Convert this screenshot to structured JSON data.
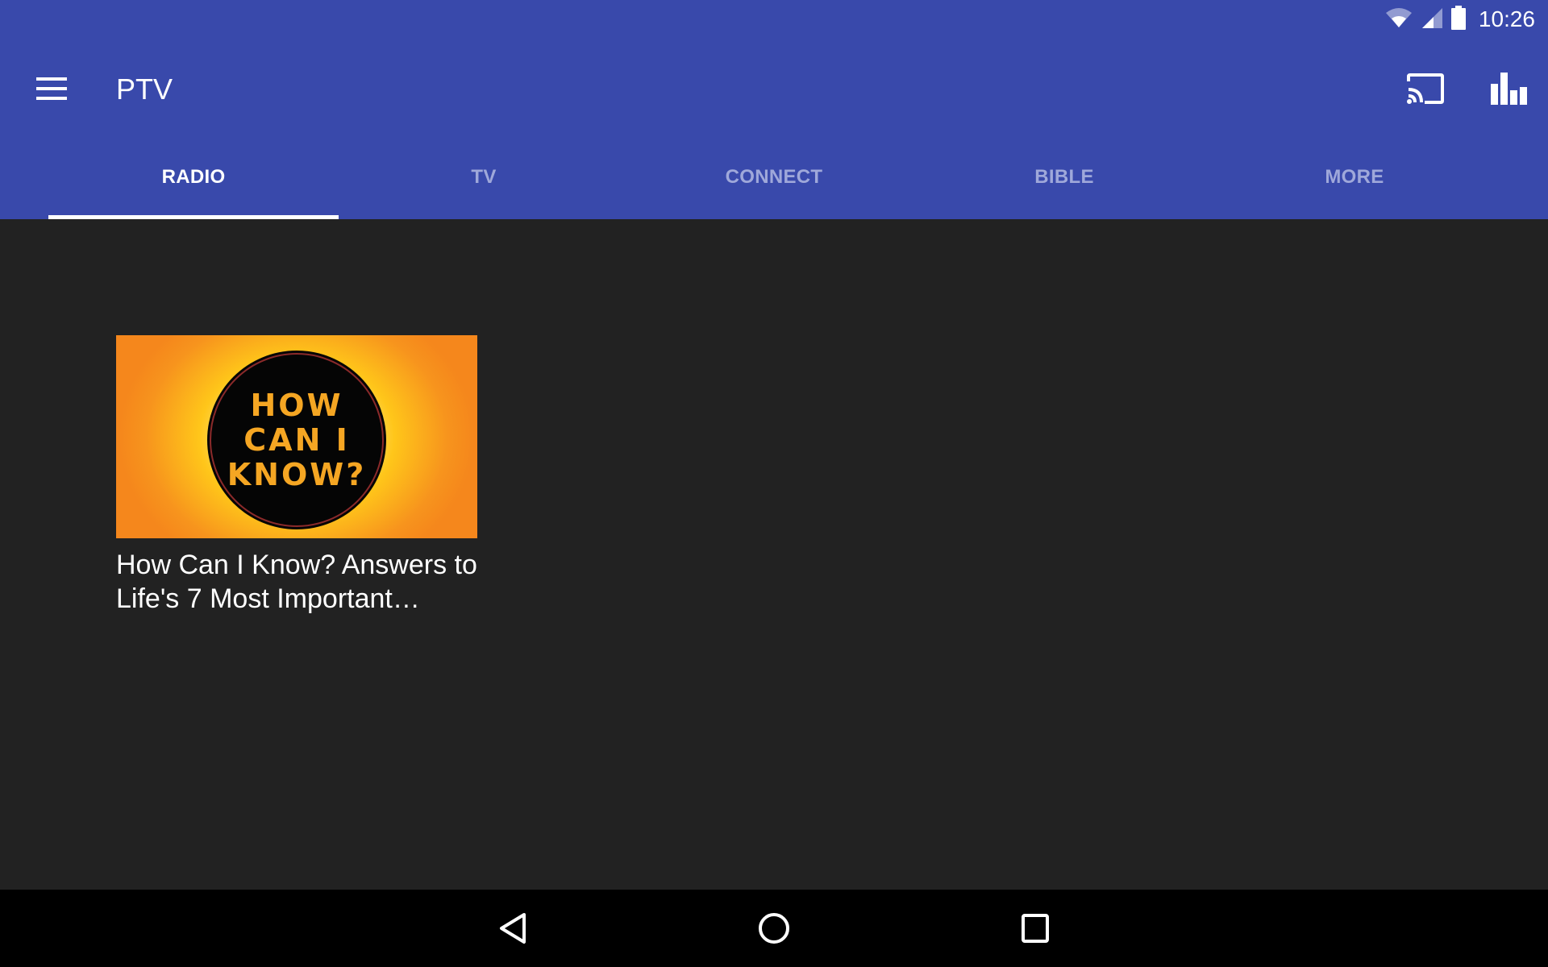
{
  "status_bar": {
    "time": "10:26",
    "icons": [
      "wifi-icon",
      "cellular-signal-icon",
      "battery-icon"
    ]
  },
  "toolbar": {
    "title": "PTV",
    "menu_icon": "hamburger-menu-icon",
    "actions": [
      "cast-icon",
      "bar-chart-icon"
    ]
  },
  "tabs": [
    {
      "label": "RADIO",
      "active": true
    },
    {
      "label": "TV",
      "active": false
    },
    {
      "label": "CONNECT",
      "active": false
    },
    {
      "label": "BIBLE",
      "active": false
    },
    {
      "label": "MORE",
      "active": false
    }
  ],
  "content": {
    "items": [
      {
        "thumbnail_text": [
          "HOW",
          "CAN I",
          "KNOW?"
        ],
        "title": "How Can I Know? Answers to Life's 7 Most Important…"
      }
    ]
  },
  "colors": {
    "primary": "#3949AB",
    "tab_inactive": "#9FA8DA",
    "background": "#222222",
    "thumbnail_text": "#F5A623"
  },
  "nav_bar": {
    "buttons": [
      "back-icon",
      "home-icon",
      "recents-icon"
    ]
  }
}
